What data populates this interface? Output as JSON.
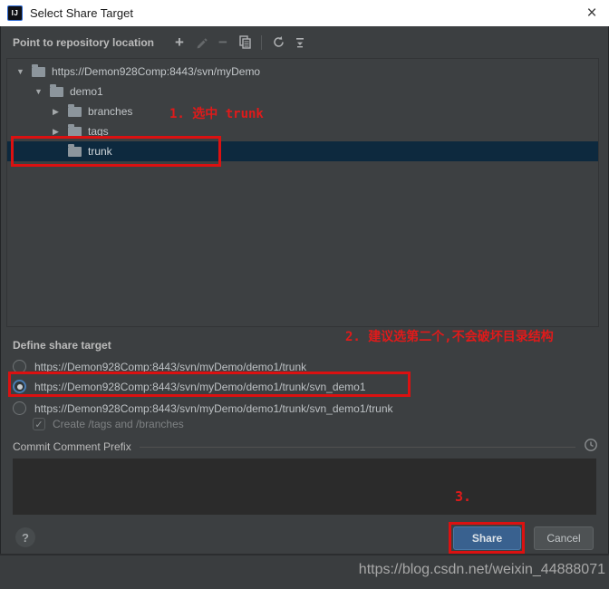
{
  "window": {
    "title": "Select Share Target",
    "close_glyph": "×",
    "app_icon": "IJ"
  },
  "toolbar": {
    "label": "Point to repository location",
    "plus_glyph": "+",
    "minus_glyph": "−"
  },
  "tree": {
    "items": [
      {
        "label": "https://Demon928Comp:8443/svn/myDemo",
        "arrow": "▼",
        "level": 0,
        "selected": false
      },
      {
        "label": "demo1",
        "arrow": "▼",
        "level": 1,
        "selected": false
      },
      {
        "label": "branches",
        "arrow": "▶",
        "level": 2,
        "selected": false
      },
      {
        "label": "tags",
        "arrow": "▶",
        "level": 2,
        "selected": false
      },
      {
        "label": "trunk",
        "arrow": "",
        "level": 2,
        "selected": true
      }
    ]
  },
  "share": {
    "heading": "Define share target",
    "options": [
      {
        "url": "https://Demon928Comp:8443/svn/myDemo/demo1/trunk",
        "selected": false
      },
      {
        "url": "https://Demon928Comp:8443/svn/myDemo/demo1/trunk/svn_demo1",
        "selected": true
      },
      {
        "url": "https://Demon928Comp:8443/svn/myDemo/demo1/trunk/svn_demo1/trunk",
        "selected": false
      }
    ],
    "checkbox": {
      "label": "Create /tags and /branches",
      "checked": true,
      "glyph": "✓"
    }
  },
  "commit": {
    "label": "Commit Comment Prefix",
    "value": ""
  },
  "footer": {
    "help_label": "?",
    "share_label": "Share",
    "cancel_label": "Cancel"
  },
  "annotations": {
    "step1": "1. 选中 trunk",
    "step2": "2. 建议选第二个,不会破坏目录结构",
    "step3": "3."
  },
  "watermark": "https://blog.csdn.net/weixin_44888071",
  "colors": {
    "selection": "#0D293E",
    "annotation_red": "#DB1111",
    "button_accent": "#39618F",
    "dialog_bg": "#3C3F41"
  }
}
